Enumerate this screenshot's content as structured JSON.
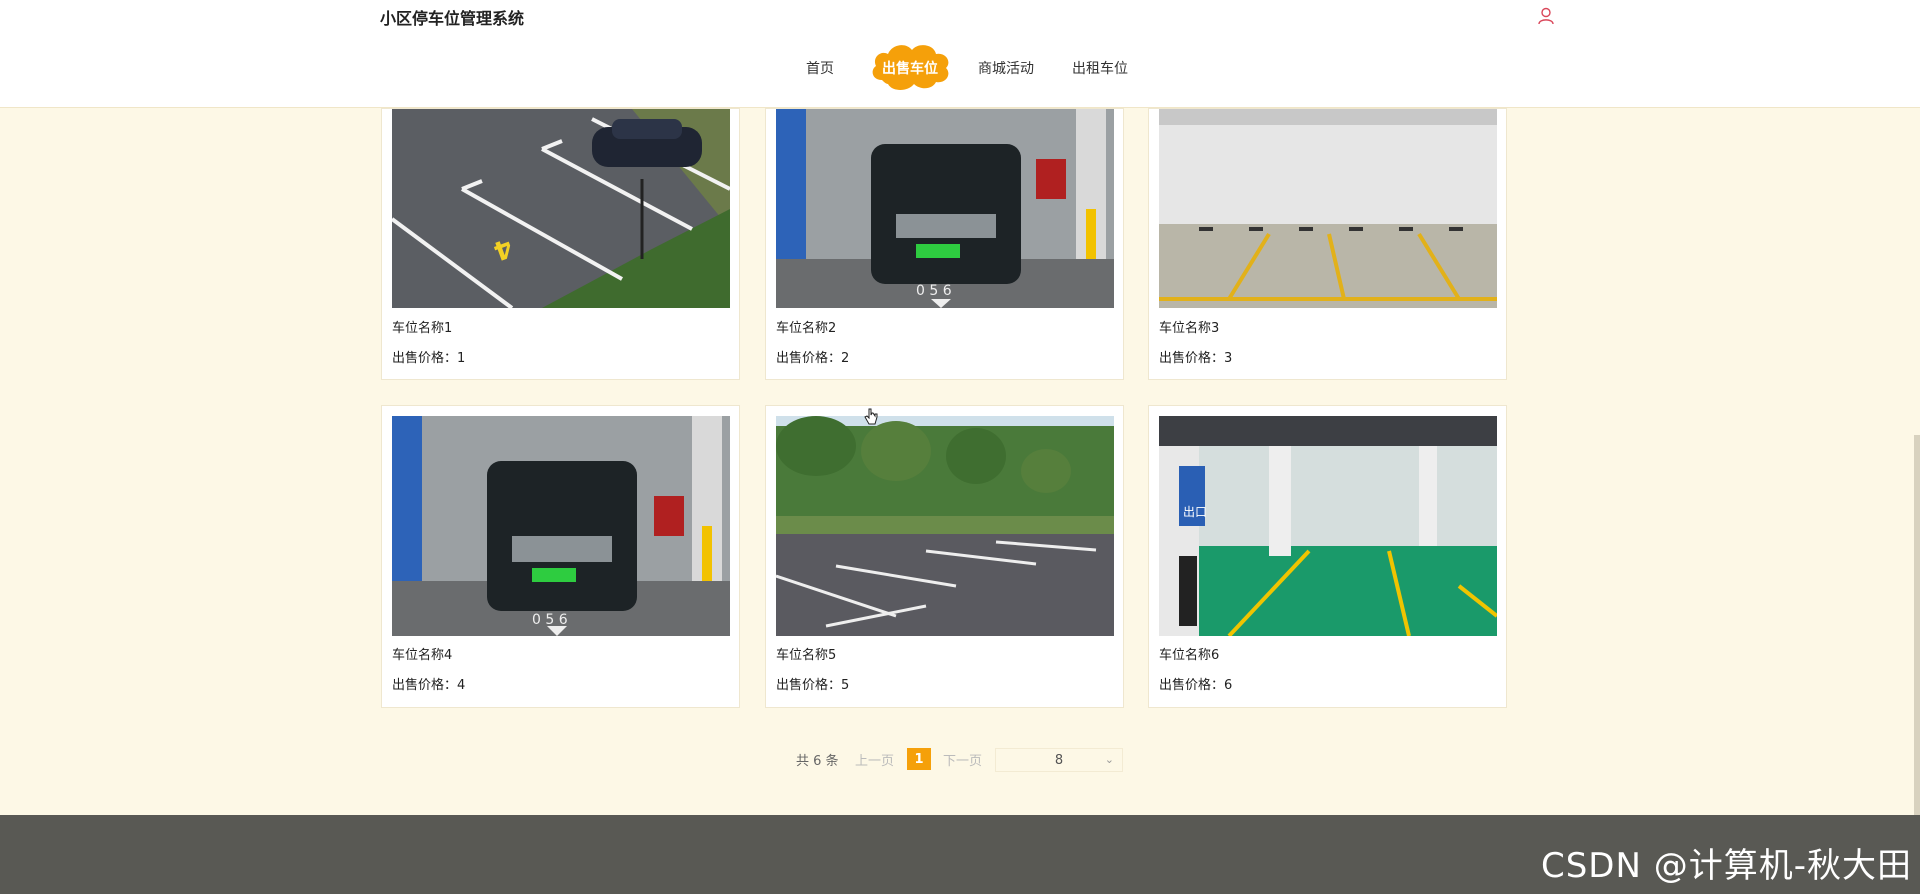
{
  "header": {
    "site_title": "小区停车位管理系统",
    "user_icon": "user-icon"
  },
  "nav": {
    "items": [
      {
        "label": "首页"
      },
      {
        "label": "出售车位",
        "active": true
      },
      {
        "label": "商城活动"
      },
      {
        "label": "出租车位"
      }
    ],
    "active_color": "#f5a00a"
  },
  "cards": [
    {
      "name": "车位名称1",
      "price": "出售价格：1"
    },
    {
      "name": "车位名称2",
      "price": "出售价格：2"
    },
    {
      "name": "车位名称3",
      "price": "出售价格：3"
    },
    {
      "name": "车位名称4",
      "price": "出售价格：4"
    },
    {
      "name": "车位名称5",
      "price": "出售价格：5"
    },
    {
      "name": "车位名称6",
      "price": "出售价格：6"
    }
  ],
  "pagination": {
    "total": "共 6 条",
    "prev": "上一页",
    "current": "1",
    "next": "下一页",
    "page_size": "8"
  },
  "footer": {
    "watermark": "CSDN @计算机-秋大田",
    "background": "#595954"
  }
}
